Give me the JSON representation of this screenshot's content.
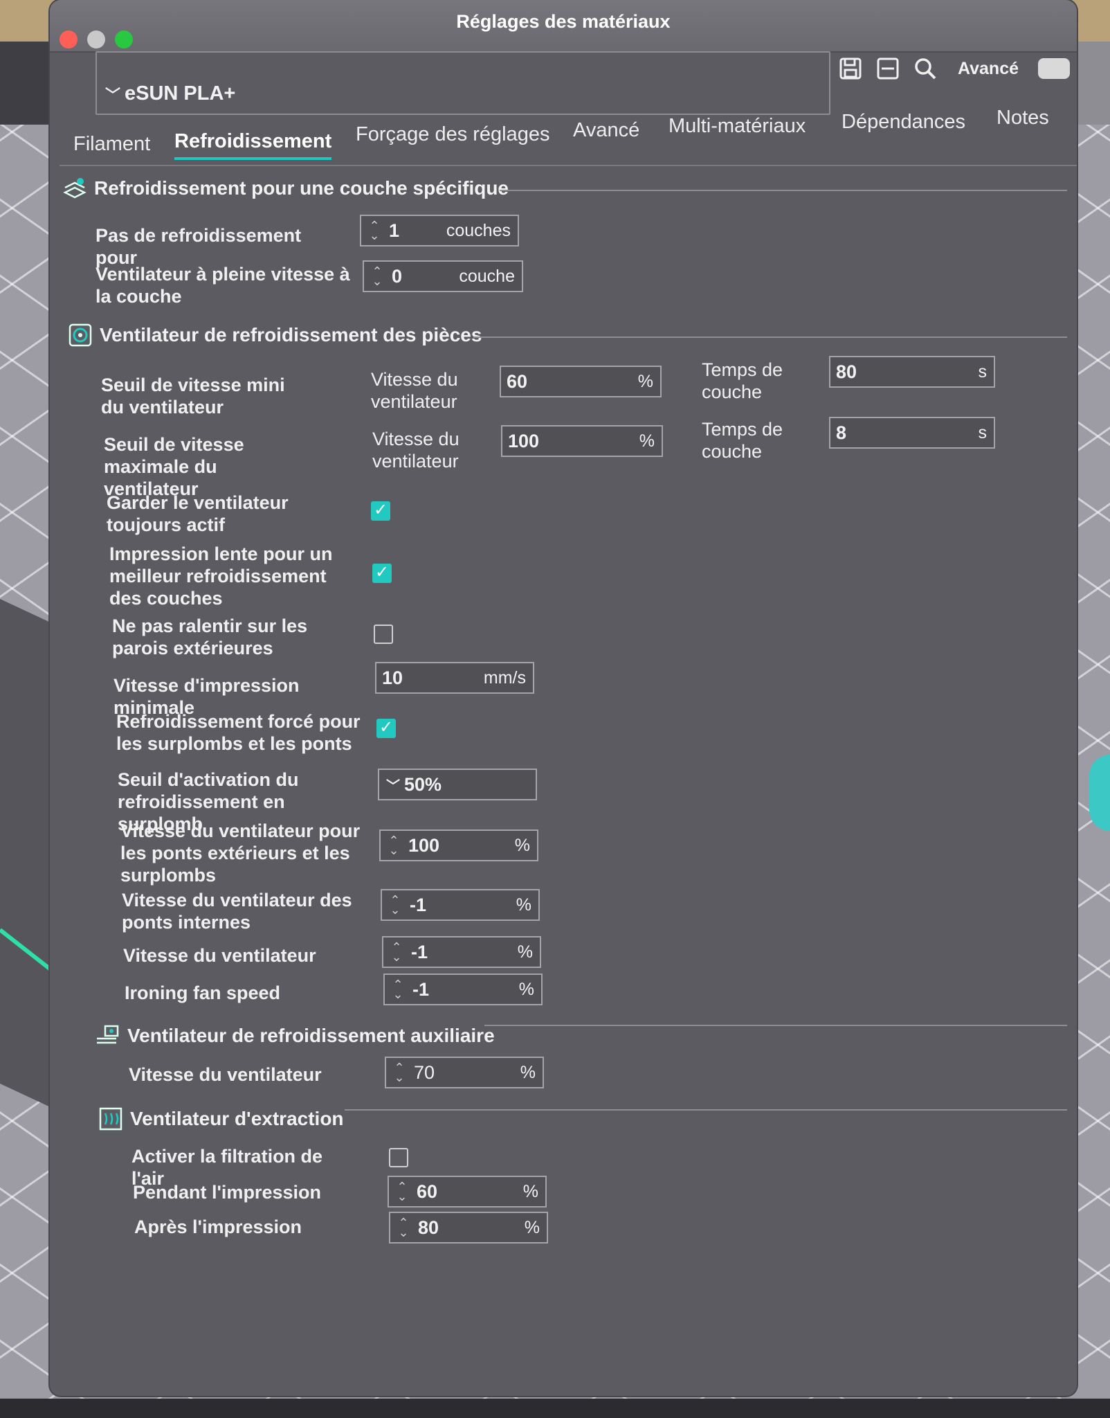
{
  "window": {
    "title": "Réglages des matériaux"
  },
  "toolbar": {
    "preset": "eSUN PLA+",
    "advanced_label": "Avancé",
    "icons": [
      "save-icon",
      "compare-icon",
      "search-icon"
    ]
  },
  "tabs": [
    {
      "label": "Filament"
    },
    {
      "label": "Refroidissement"
    },
    {
      "label": "Forçage des réglages"
    },
    {
      "label": "Avancé"
    },
    {
      "label": "Multi-matériaux"
    },
    {
      "label": "Dépendances"
    },
    {
      "label": "Notes"
    }
  ],
  "sec1": {
    "title": "Refroidissement pour une couche spécifique",
    "no_cooling": {
      "label": "Pas de refroidissement pour",
      "value": "1",
      "unit": "couches"
    },
    "full_fan": {
      "label": "Ventilateur à pleine vitesse à la couche",
      "value": "0",
      "unit": "couche"
    }
  },
  "sec2": {
    "title": "Ventilateur de refroidissement des pièces",
    "min_thr": {
      "label": "Seuil de vitesse mini du ventilateur",
      "fan_label": "Vitesse du ventilateur",
      "fan_value": "60",
      "fan_unit": "%",
      "time_label": "Temps de couche",
      "time_value": "80",
      "time_unit": "s"
    },
    "max_thr": {
      "label": "Seuil de vitesse maximale du ventilateur",
      "fan_label": "Vitesse du ventilateur",
      "fan_value": "100",
      "fan_unit": "%",
      "time_label": "Temps de couche",
      "time_value": "8",
      "time_unit": "s"
    },
    "keep_fan": {
      "label": "Garder le ventilateur toujours actif",
      "checked": true
    },
    "slow_down": {
      "label": "Impression lente pour un meilleur refroidissement des couches",
      "checked": true
    },
    "no_slow_outer": {
      "label": "Ne pas ralentir sur les parois extérieures",
      "checked": false
    },
    "min_speed": {
      "label": "Vitesse d'impression minimale",
      "value": "10",
      "unit": "mm/s"
    },
    "forced_overhang": {
      "label": "Refroidissement forcé pour les surplombs et les ponts",
      "checked": true
    },
    "overhang_thr": {
      "label": "Seuil d'activation du refroidissement en surplomb",
      "value": "50%"
    },
    "bridge_fan": {
      "label": "Vitesse du ventilateur pour les ponts extérieurs et les surplombs",
      "value": "100",
      "unit": "%"
    },
    "internal_bridge": {
      "label": "Vitesse du ventilateur des ponts internes",
      "value": "-1",
      "unit": "%"
    },
    "fan_speed": {
      "label": "Vitesse du ventilateur",
      "value": "-1",
      "unit": "%"
    },
    "ironing_fan": {
      "label": "Ironing fan speed",
      "value": "-1",
      "unit": "%"
    }
  },
  "sec3": {
    "title": "Ventilateur de refroidissement auxiliaire",
    "aux_fan": {
      "label": "Vitesse du ventilateur",
      "value": "70",
      "unit": "%"
    }
  },
  "sec4": {
    "title": "Ventilateur d'extraction",
    "filtration": {
      "label": "Activer la filtration de l'air",
      "checked": false
    },
    "during": {
      "label": "Pendant l'impression",
      "value": "60",
      "unit": "%"
    },
    "after": {
      "label": "Après l'impression",
      "value": "80",
      "unit": "%"
    }
  },
  "colors": {
    "accent": "#1ec8c0",
    "window_bg": "#5c5b61"
  }
}
